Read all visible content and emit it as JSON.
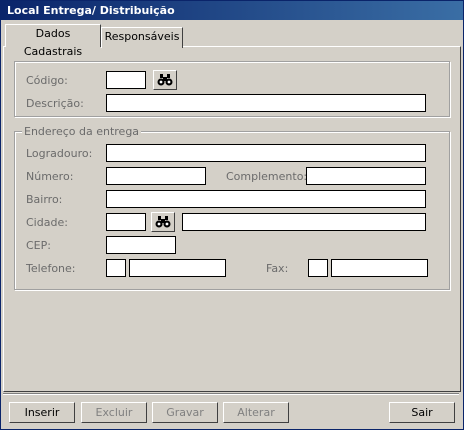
{
  "window": {
    "title": "Local Entrega/ Distribuição"
  },
  "tabs": [
    "Dados Cadastrais",
    "Responsáveis"
  ],
  "identification": {
    "codigo_label": "Código:",
    "descricao_label": "Descrição:"
  },
  "address": {
    "group_title": "Endereço da entrega",
    "logradouro_label": "Logradouro:",
    "numero_label": "Número:",
    "complemento_label": "Complemento:",
    "bairro_label": "Bairro:",
    "cidade_label": "Cidade:",
    "cep_label": "CEP:",
    "telefone_label": "Telefone:",
    "fax_label": "Fax:"
  },
  "buttons": {
    "inserir": "Inserir",
    "excluir": "Excluir",
    "gravar": "Gravar",
    "alterar": "Alterar",
    "sair": "Sair"
  },
  "icons": {
    "search": "binoculars-icon"
  }
}
